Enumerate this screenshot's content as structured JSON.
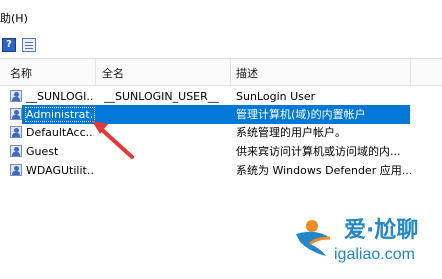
{
  "menubar": {
    "help_label": "助(H)"
  },
  "toolbar": {
    "help_button": "?",
    "properties_button": "properties"
  },
  "columns": [
    "名称",
    "全名",
    "描述"
  ],
  "rows": [
    {
      "name": "__SUNLOGI...",
      "full": "__SUNLOGIN_USER__",
      "desc": "SunLogin User"
    },
    {
      "name": "Administrat...",
      "full": "",
      "desc": "管理计算机(域)的内置帐户"
    },
    {
      "name": "DefaultAcc...",
      "full": "",
      "desc": "系统管理的用户帐户。"
    },
    {
      "name": "Guest",
      "full": "",
      "desc": "供来宾访问计算机或访问域的内..."
    },
    {
      "name": "WDAGUtilit...",
      "full": "",
      "desc": "系统为 Windows Defender 应用..."
    }
  ],
  "selected_row": 1,
  "watermark": {
    "title": "爱·尬聊",
    "domain": "igaliao.com"
  },
  "colors": {
    "selection": "#0078d7",
    "arrow": "#e53935",
    "watermark": "#2387c8"
  }
}
